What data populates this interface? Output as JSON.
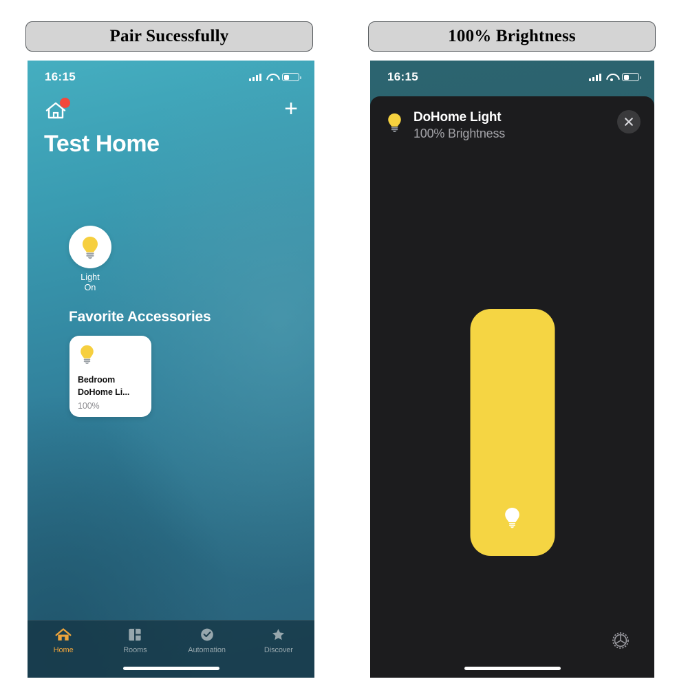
{
  "captions": {
    "left": "Pair Sucessfully",
    "right": "100% Brightness"
  },
  "left_phone": {
    "status_bar": {
      "time": "16:15",
      "cellular_icon": "signal-bars-icon",
      "wifi_icon": "wifi-icon",
      "battery_icon": "battery-icon",
      "battery_level_percent": 35
    },
    "header": {
      "home_icon": "home-icon",
      "notification_badge": "badge-dot",
      "add_label": "+",
      "title": "Test Home"
    },
    "status_chip": {
      "icon": "lightbulb-icon",
      "line1": "Light",
      "line2": "On"
    },
    "favorites": {
      "section_title": "Favorite Accessories",
      "accessories": [
        {
          "icon": "lightbulb-icon",
          "room": "Bedroom",
          "name": "DoHome Li...",
          "value": "100%"
        }
      ]
    },
    "tabbar": {
      "items": [
        {
          "label": "Home",
          "icon": "home-icon",
          "active": true
        },
        {
          "label": "Rooms",
          "icon": "rooms-icon",
          "active": false
        },
        {
          "label": "Automation",
          "icon": "clock-check-icon",
          "active": false
        },
        {
          "label": "Discover",
          "icon": "star-icon",
          "active": false
        }
      ]
    }
  },
  "right_phone": {
    "status_bar": {
      "time": "16:15",
      "cellular_icon": "signal-bars-icon",
      "wifi_icon": "wifi-icon",
      "battery_icon": "battery-icon",
      "battery_level_percent": 35
    },
    "sheet": {
      "icon": "lightbulb-icon",
      "title": "DoHome Light",
      "subtitle": "100% Brightness",
      "close_icon": "close-icon"
    },
    "brightness_slider": {
      "value_percent": 100,
      "fill_color": "#f5d543",
      "track_color": "#2c2c2e",
      "handle_icon": "lightbulb-icon"
    },
    "settings_button": {
      "icon": "gear-icon"
    }
  },
  "colors": {
    "caption_bg": "#d4d4d4",
    "home_gradient_top": "#45aec0",
    "home_gradient_bottom": "#2a5f77",
    "sheet_bg": "#1c1c1e",
    "accent_yellow": "#f5d543",
    "tab_active": "#eda43c",
    "badge_red": "#f4483b"
  }
}
